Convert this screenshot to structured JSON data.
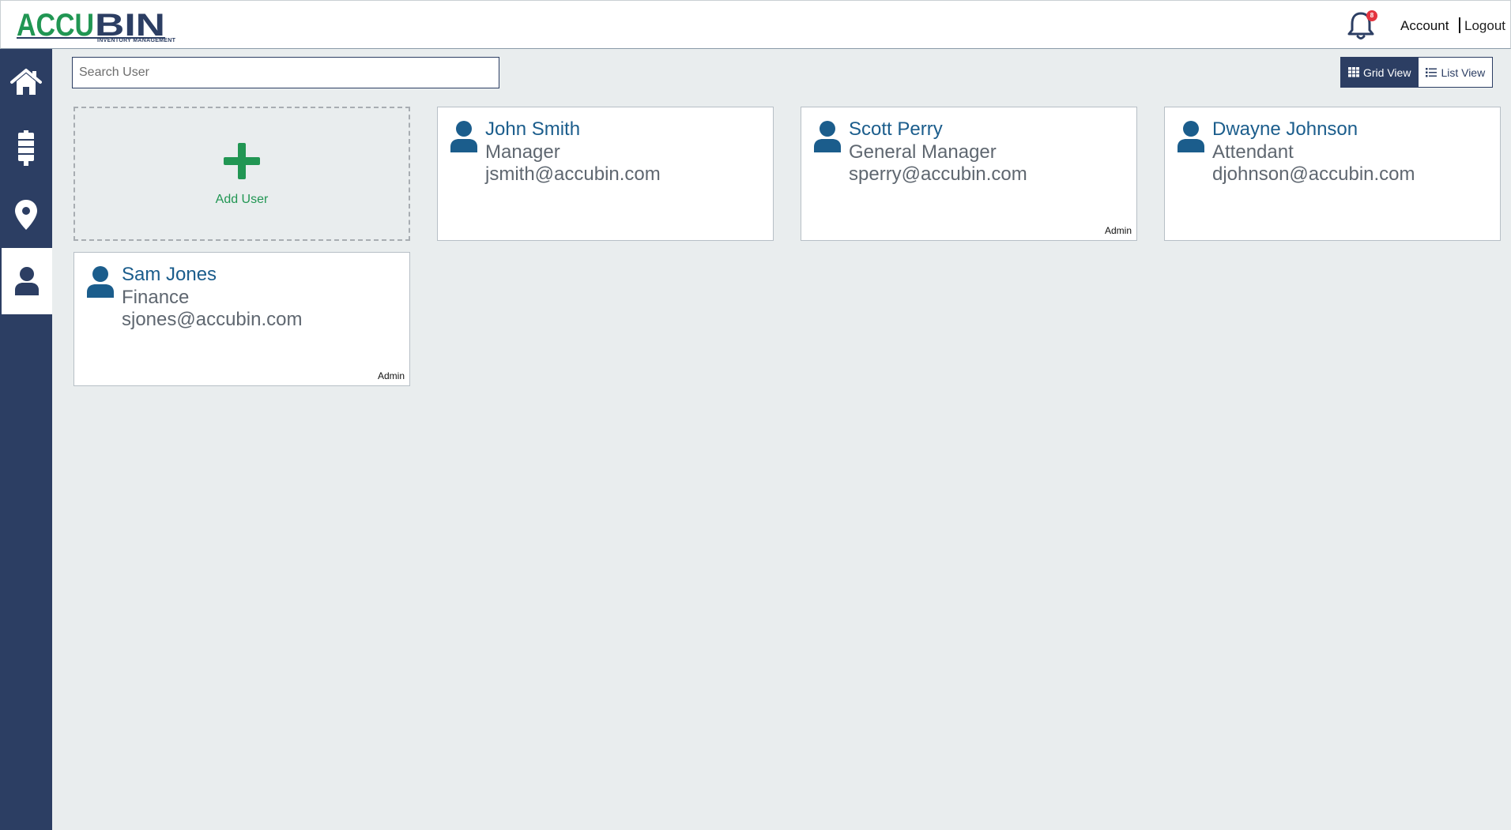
{
  "brand": {
    "logo_text": "ACCUBIN",
    "logo_sub": "INVENTORY MANAGEMENT",
    "green": "#219653",
    "navy": "#2c3e63"
  },
  "header": {
    "notification_count": "8",
    "account_label": "Account",
    "logout_label": "Logout"
  },
  "sidebar": {
    "items": [
      {
        "icon": "home-icon",
        "active": false
      },
      {
        "icon": "bin-icon",
        "active": false
      },
      {
        "icon": "location-pin-icon",
        "active": false
      },
      {
        "icon": "user-icon",
        "active": true
      }
    ]
  },
  "toolbar": {
    "search_placeholder": "Search User",
    "grid_view_label": "Grid View",
    "list_view_label": "List View"
  },
  "add_user_label": "Add User",
  "users": [
    {
      "name": "John Smith",
      "role": "Manager",
      "email": "jsmith@accubin.com",
      "badge": ""
    },
    {
      "name": "Scott Perry",
      "role": "General Manager",
      "email": "sperry@accubin.com",
      "badge": "Admin"
    },
    {
      "name": "Dwayne Johnson",
      "role": "Attendant",
      "email": "djohnson@accubin.com",
      "badge": ""
    },
    {
      "name": "Sam Jones",
      "role": "Finance",
      "email": "sjones@accubin.com",
      "badge": "Admin"
    }
  ]
}
